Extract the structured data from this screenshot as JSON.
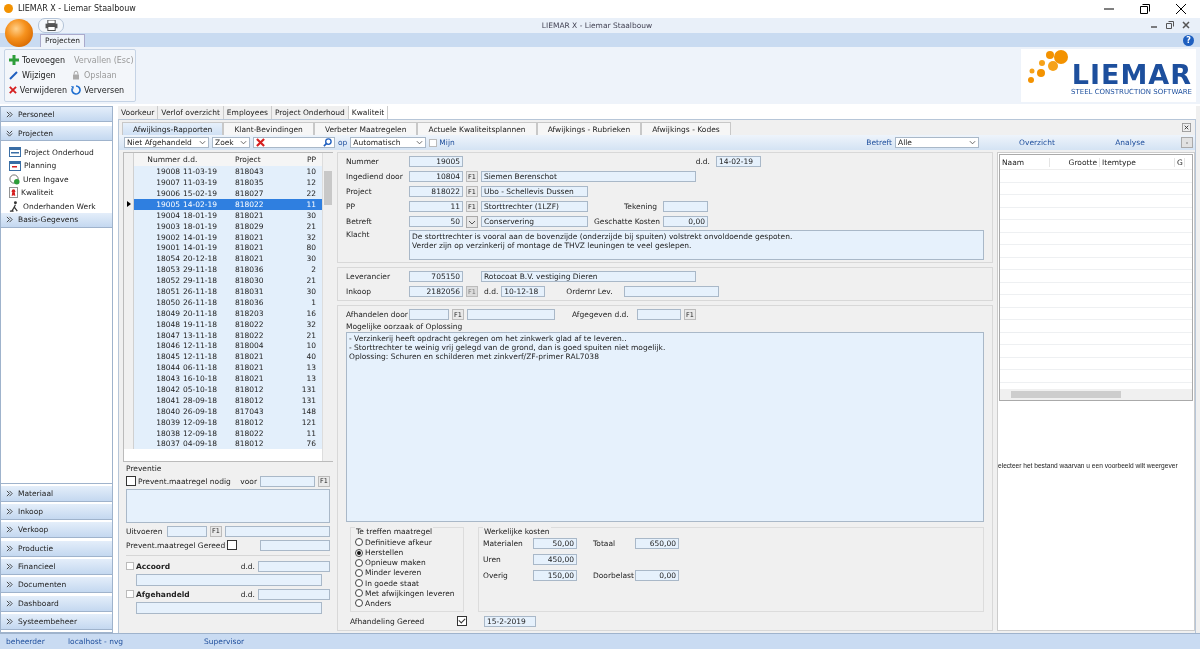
{
  "window": {
    "title": "LIEMAR X - Liemar Staalbouw",
    "app_title": "LIEMAR X - Liemar Staalbouw"
  },
  "ribbon": {
    "tabs": [
      {
        "label": "Projecten",
        "selected": true
      }
    ],
    "help": "?",
    "actions": [
      {
        "kind": "add",
        "label": "Toevoegen",
        "disabled": false
      },
      {
        "kind": "cancel",
        "label": "Vervallen (Esc)",
        "disabled": true
      },
      {
        "kind": "edit",
        "label": "Wijzigen",
        "disabled": false
      },
      {
        "kind": "save",
        "label": "Opslaan",
        "disabled": true
      },
      {
        "kind": "delete",
        "label": "Verwijderen",
        "disabled": false
      },
      {
        "kind": "refresh",
        "label": "Verversen",
        "disabled": false
      }
    ]
  },
  "logo": {
    "name": "LIEMAR",
    "tagline": "STEEL CONSTRUCTION SOFTWARE"
  },
  "sidebar": {
    "groups": [
      {
        "label": "Personeel",
        "expanded": false
      },
      {
        "label": "Projecten",
        "expanded": true,
        "children": [
          {
            "kind": "window",
            "label": "Project Onderhoud"
          },
          {
            "kind": "calendar",
            "label": "Planning"
          },
          {
            "kind": "clock",
            "label": "Uren Ingave"
          },
          {
            "kind": "badge",
            "label": "Kwaliteit"
          },
          {
            "kind": "worker",
            "label": "Onderhanden Werk"
          }
        ]
      },
      {
        "label": "Basis-Gegevens",
        "expanded": false
      }
    ],
    "bottom": [
      {
        "label": "Materiaal"
      },
      {
        "label": "Inkoop"
      },
      {
        "label": "Verkoop"
      },
      {
        "label": "Productie"
      },
      {
        "label": "Financieel"
      },
      {
        "label": "Documenten"
      },
      {
        "label": "Dashboard"
      },
      {
        "label": "Systeembeheer"
      }
    ]
  },
  "module_tabs": [
    {
      "label": "Voorkeur",
      "selected": false
    },
    {
      "label": "Verlof overzicht",
      "selected": false
    },
    {
      "label": "Employees",
      "selected": false
    },
    {
      "label": "Project Onderhoud",
      "selected": false
    },
    {
      "label": "Kwaliteit",
      "selected": true
    }
  ],
  "sub_tabs": [
    {
      "label": "Afwijkings-Rapporten",
      "selected": true
    },
    {
      "label": "Klant-Bevindingen",
      "selected": false
    },
    {
      "label": "Verbeter Maatregelen",
      "selected": false
    },
    {
      "label": "Actuele Kwaliteitsplannen",
      "selected": false
    },
    {
      "label": "Afwijkings - Rubrieken",
      "selected": false
    },
    {
      "label": "Afwijkings - Kodes",
      "selected": false
    }
  ],
  "filters": {
    "status": "Niet Afgehandeld",
    "search_mode": "Zoek",
    "op_label": "op",
    "op_value": "Automatisch",
    "mine": {
      "label": "Mijn",
      "checked": false
    },
    "betreft_label": "Betreft",
    "betreft_value": "Alle",
    "overview": "Overzicht",
    "analysis": "Analyse",
    "collapse": "-"
  },
  "list": {
    "columns": [
      "Nummer",
      "d.d.",
      "Project",
      "PP"
    ],
    "rows": [
      {
        "nummer": "19008",
        "dd": "11-03-19",
        "project": "818043",
        "pp": "10",
        "selected": false
      },
      {
        "nummer": "19007",
        "dd": "11-03-19",
        "project": "818035",
        "pp": "12",
        "selected": false
      },
      {
        "nummer": "19006",
        "dd": "15-02-19",
        "project": "818027",
        "pp": "22",
        "selected": false
      },
      {
        "nummer": "19005",
        "dd": "14-02-19",
        "project": "818022",
        "pp": "11",
        "selected": true
      },
      {
        "nummer": "19004",
        "dd": "18-01-19",
        "project": "818021",
        "pp": "30",
        "selected": false
      },
      {
        "nummer": "19003",
        "dd": "18-01-19",
        "project": "818029",
        "pp": "21",
        "selected": false
      },
      {
        "nummer": "19002",
        "dd": "14-01-19",
        "project": "818021",
        "pp": "32",
        "selected": false
      },
      {
        "nummer": "19001",
        "dd": "14-01-19",
        "project": "818021",
        "pp": "80",
        "selected": false
      },
      {
        "nummer": "18054",
        "dd": "20-12-18",
        "project": "818021",
        "pp": "30",
        "selected": false
      },
      {
        "nummer": "18053",
        "dd": "29-11-18",
        "project": "818036",
        "pp": "2",
        "selected": false
      },
      {
        "nummer": "18052",
        "dd": "29-11-18",
        "project": "818030",
        "pp": "21",
        "selected": false
      },
      {
        "nummer": "18051",
        "dd": "26-11-18",
        "project": "818031",
        "pp": "30",
        "selected": false
      },
      {
        "nummer": "18050",
        "dd": "26-11-18",
        "project": "818036",
        "pp": "1",
        "selected": false
      },
      {
        "nummer": "18049",
        "dd": "20-11-18",
        "project": "818203",
        "pp": "16",
        "selected": false
      },
      {
        "nummer": "18048",
        "dd": "19-11-18",
        "project": "818022",
        "pp": "32",
        "selected": false
      },
      {
        "nummer": "18047",
        "dd": "13-11-18",
        "project": "818022",
        "pp": "21",
        "selected": false
      },
      {
        "nummer": "18046",
        "dd": "12-11-18",
        "project": "818004",
        "pp": "10",
        "selected": false
      },
      {
        "nummer": "18045",
        "dd": "12-11-18",
        "project": "818021",
        "pp": "40",
        "selected": false
      },
      {
        "nummer": "18044",
        "dd": "06-11-18",
        "project": "818021",
        "pp": "13",
        "selected": false
      },
      {
        "nummer": "18043",
        "dd": "16-10-18",
        "project": "818021",
        "pp": "13",
        "selected": false
      },
      {
        "nummer": "18042",
        "dd": "05-10-18",
        "project": "818012",
        "pp": "131",
        "selected": false
      },
      {
        "nummer": "18041",
        "dd": "28-09-18",
        "project": "818012",
        "pp": "131",
        "selected": false
      },
      {
        "nummer": "18040",
        "dd": "26-09-18",
        "project": "817043",
        "pp": "148",
        "selected": false
      },
      {
        "nummer": "18039",
        "dd": "12-09-18",
        "project": "818012",
        "pp": "121",
        "selected": false
      },
      {
        "nummer": "18038",
        "dd": "12-09-18",
        "project": "818022",
        "pp": "11",
        "selected": false
      },
      {
        "nummer": "18037",
        "dd": "04-09-18",
        "project": "818012",
        "pp": "76",
        "selected": false
      }
    ]
  },
  "preventie": {
    "title": "Preventie",
    "needed": {
      "label": "Prevent.maatregel nodig",
      "checked": false
    },
    "voor_label": "voor",
    "voor_button": "F1",
    "uitvoeren_label": "Uitvoeren",
    "uitvoeren_button": "F1",
    "done": {
      "label": "Prevent.maatregel Gereed",
      "checked": false
    },
    "accoord": {
      "label": "Accoord",
      "checked": false,
      "date_label": "d.d."
    },
    "afgehandeld": {
      "label": "Afgehandeld",
      "checked": false,
      "date_label": "d.d."
    }
  },
  "form": {
    "rows": [
      {
        "kind": "input",
        "label": "Nummer",
        "value": "19005",
        "right_label": "d.d.",
        "right_value": "14-02-19"
      },
      {
        "kind": "input",
        "label": "Ingediend door",
        "value": "10804",
        "button": "F1",
        "text": "Siemen Berenschot"
      },
      {
        "kind": "input",
        "label": "Project",
        "value": "818022",
        "button": "F1",
        "text": "Ubo - Schellevis Dussen"
      },
      {
        "kind": "input",
        "label": "PP",
        "value": "11",
        "button": "F1",
        "text": "Storttrechter (1LZF)",
        "right_label": "Tekening",
        "right_value": ""
      },
      {
        "kind": "select",
        "label": "Betreft",
        "value": "50",
        "text": "Conservering",
        "right_label": "Geschatte Kosten",
        "right_value": "0,00"
      }
    ],
    "klacht_label": "Klacht",
    "klacht": [
      "De storttrechter is vooral aan de bovenzijde (onderzijde bij spuiten) volstrekt onvoldoende gespoten.",
      "Verder zijn op verzinkerij of montage de THVZ leuningen te veel geslepen."
    ],
    "leverancier_label": "Leverancier",
    "leverancier": "705150",
    "leverancier_name": "Rotocoat B.V. vestiging Dieren",
    "inkoop_label": "Inkoop",
    "inkoop": "2182056",
    "inkoop_button": "F1",
    "inkoop_button_disabled": true,
    "inkoop_dd_label": "d.d.",
    "inkoop_dd": "10-12-18",
    "ordernr_label": "Ordernr Lev.",
    "afhandelen_label": "Afhandelen door",
    "afhandelen_button": "F1",
    "afgegeven_label": "Afgegeven d.d.",
    "afgegeven_button": "F1",
    "oorzaak_label": "Mogelijke oorzaak of Oplossing",
    "oorzaak": [
      "- Verzinkerij heeft opdracht gekregen om het zinkwerk glad af te leveren..",
      "- Storttrechter te weinig vrij gelegd van de grond, dan is goed spuiten niet mogelijk.",
      "Oplossing: Schuren en schilderen met zinkverf/ZF-primer RAL7038"
    ],
    "maatregel_title": "Te treffen maatregel",
    "maatregel": [
      {
        "label": "Definitieve afkeur",
        "selected": false
      },
      {
        "label": "Herstellen",
        "selected": true
      },
      {
        "label": "Opnieuw maken",
        "selected": false
      },
      {
        "label": "Minder leveren",
        "selected": false
      },
      {
        "label": "In goede staat",
        "selected": false
      },
      {
        "label": "Met afwijkingen leveren",
        "selected": false
      },
      {
        "label": "Anders",
        "selected": false
      }
    ],
    "kosten_title": "Werkelijke kosten",
    "kosten": [
      {
        "label": "Materialen",
        "value": "50,00",
        "right_label": "Totaal",
        "right_value": "650,00"
      },
      {
        "label": "Uren",
        "value": "450,00"
      },
      {
        "label": "Overig",
        "value": "150,00",
        "right_label": "Doorbelast",
        "right_value": "0,00"
      }
    ],
    "gereed": {
      "label": "Afhandeling Gereed",
      "checked": true,
      "date": "15-2-2019"
    }
  },
  "files": {
    "columns": [
      "Naam",
      "Grootte",
      "Itemtype",
      "G"
    ],
    "message": "electeer het bestand waarvan u een voorbeeld wilt weergever"
  },
  "status_bar": [
    "beheerder",
    "localhost - nvg",
    "Supervisor"
  ]
}
